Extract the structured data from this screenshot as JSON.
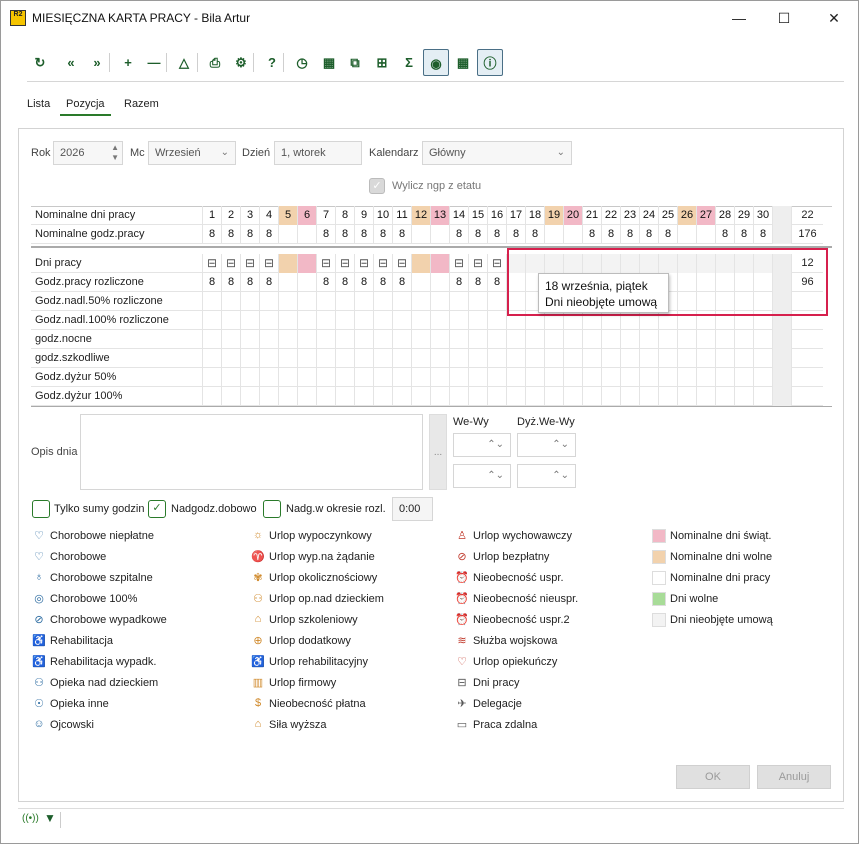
{
  "window": {
    "logo": "R2",
    "title": "MIESIĘCZNA KARTA PRACY - Bila Artur",
    "minimize": "—",
    "maximize": "☐",
    "close": "✕"
  },
  "toolbar": [
    {
      "name": "refresh-icon",
      "glyph": "↻"
    },
    {
      "name": "prev-icon",
      "glyph": "«"
    },
    {
      "name": "next-icon",
      "glyph": "»"
    },
    {
      "name": "add-icon",
      "glyph": "+"
    },
    {
      "name": "remove-icon",
      "glyph": "—"
    },
    {
      "name": "triangle-icon",
      "glyph": "△"
    },
    {
      "name": "print-icon",
      "glyph": "⎙"
    },
    {
      "name": "settings-icon",
      "glyph": "⚙"
    },
    {
      "name": "help-icon",
      "glyph": "?"
    },
    {
      "name": "clock-icon",
      "glyph": "◷"
    },
    {
      "name": "calendar-remove-icon",
      "glyph": "▦"
    },
    {
      "name": "copy-icon",
      "glyph": "⧉"
    },
    {
      "name": "add-box-icon",
      "glyph": "⊞"
    },
    {
      "name": "sum-icon",
      "glyph": "Σ"
    },
    {
      "name": "eye-icon",
      "glyph": "◉"
    },
    {
      "name": "calendar-clock-icon",
      "glyph": "▦"
    },
    {
      "name": "info-icon",
      "glyph": "ⓘ"
    }
  ],
  "tabs": [
    "Lista",
    "Pozycja",
    "Razem"
  ],
  "form": {
    "rok_label": "Rok",
    "rok_value": "2026",
    "mc_label": "Mc",
    "mc_value": "Wrzesień",
    "dzien_label": "Dzień",
    "dzien_value": "1, wtorek",
    "kalendarz_label": "Kalendarz",
    "kalendarz_value": "Główny",
    "wylicz_label": "Wylicz ngp z etatu"
  },
  "days": [
    "1",
    "2",
    "3",
    "4",
    "5",
    "6",
    "7",
    "8",
    "9",
    "10",
    "11",
    "12",
    "13",
    "14",
    "15",
    "16",
    "17",
    "18",
    "19",
    "20",
    "21",
    "22",
    "23",
    "24",
    "25",
    "26",
    "27",
    "28",
    "29",
    "30"
  ],
  "day_types": [
    "w",
    "w",
    "w",
    "w",
    "o",
    "h",
    "w",
    "w",
    "w",
    "w",
    "w",
    "o",
    "h",
    "w",
    "w",
    "w",
    "w",
    "w",
    "o",
    "h",
    "w",
    "w",
    "w",
    "w",
    "w",
    "o",
    "h",
    "w",
    "w",
    "w"
  ],
  "rows": {
    "nominalne_dni": {
      "label": "Nominalne dni pracy",
      "total": "22"
    },
    "nominalne_godz": {
      "label": "Nominalne godz.pracy",
      "values": [
        "8",
        "8",
        "8",
        "8",
        "",
        "",
        "8",
        "8",
        "8",
        "8",
        "8",
        "",
        "",
        "8",
        "8",
        "8",
        "8",
        "8",
        "",
        "",
        "8",
        "8",
        "8",
        "8",
        "8",
        "",
        "",
        "8",
        "8",
        "8"
      ],
      "total": "176"
    },
    "dni_pracy": {
      "label": "Dni pracy",
      "total": "12"
    },
    "godz_rozliczone": {
      "label": "Godz.pracy rozliczone",
      "values": [
        "8",
        "8",
        "8",
        "8",
        "",
        "",
        "8",
        "8",
        "8",
        "8",
        "8",
        "",
        "",
        "8",
        "8",
        "8",
        "",
        "",
        "",
        "",
        "",
        "",
        "",
        "",
        "",
        "",
        "",
        "",
        "",
        ""
      ],
      "total": "96"
    },
    "nadl50": {
      "label": "Godz.nadl.50% rozliczone"
    },
    "nadl100": {
      "label": "Godz.nadl.100% rozliczone"
    },
    "nocne": {
      "label": "godz.nocne"
    },
    "szkodliwe": {
      "label": "godz.szkodliwe"
    },
    "dyzur50": {
      "label": "Godz.dyżur 50%"
    },
    "dyzur100": {
      "label": "Godz.dyżur 100%"
    }
  },
  "tooltip": {
    "line1": "18 września, piątek",
    "line2": "Dni nieobjęte umową"
  },
  "opis": {
    "label": "Opis dnia",
    "dots": "...",
    "we_wy": "We-Wy",
    "dyz_we_wy": "Dyż.We-Wy"
  },
  "options": {
    "tylko_sumy": "Tylko sumy godzin",
    "nadgodz_dobowo": "Nadgodz.dobowo",
    "nadg_okres": "Nadg.w okresie rozl.",
    "time_value": "0:00"
  },
  "legend_col1": [
    "Chorobowe niepłatne",
    "Chorobowe",
    "Chorobowe szpitalne",
    "Chorobowe 100%",
    "Chorobowe wypadkowe",
    "Rehabilitacja",
    "Rehabilitacja wypadk.",
    "Opieka nad dzieckiem",
    "Opieka inne",
    "Ojcowski"
  ],
  "legend_col2": [
    "Urlop wypoczynkowy",
    "Urlop wyp.na żądanie",
    "Urlop okolicznościowy",
    "Urlop op.nad dzieckiem",
    "Urlop szkoleniowy",
    "Urlop dodatkowy",
    "Urlop rehabilitacyjny",
    "Urlop firmowy",
    "Nieobecność płatna",
    "Siła wyższa"
  ],
  "legend_col3": [
    "Urlop wychowawczy",
    "Urlop bezpłatny",
    "Nieobecność uspr.",
    "Nieobecność nieuspr.",
    "Nieobecność uspr.2",
    "Służba wojskowa",
    "Urlop opiekuńczy",
    "Dni pracy",
    "Delegacje",
    "Praca zdalna"
  ],
  "legend_col4": [
    {
      "label": "Nominalne dni świąt.",
      "color": "#f2b8c6"
    },
    {
      "label": "Nominalne dni wolne",
      "color": "#f2d2ad"
    },
    {
      "label": "Nominalne dni pracy",
      "color": "#ffffff"
    },
    {
      "label": "Dni wolne",
      "color": "#a8dc98"
    },
    {
      "label": "Dni nieobjęte umową",
      "color": "#f3f3f3"
    }
  ],
  "buttons": {
    "ok": "OK",
    "anuluj": "Anuluj"
  },
  "colors": {
    "holiday": "#f2b8c6",
    "free": "#f2d2ad",
    "accent": "#2a7a2a",
    "highlight": "#d6204d"
  }
}
